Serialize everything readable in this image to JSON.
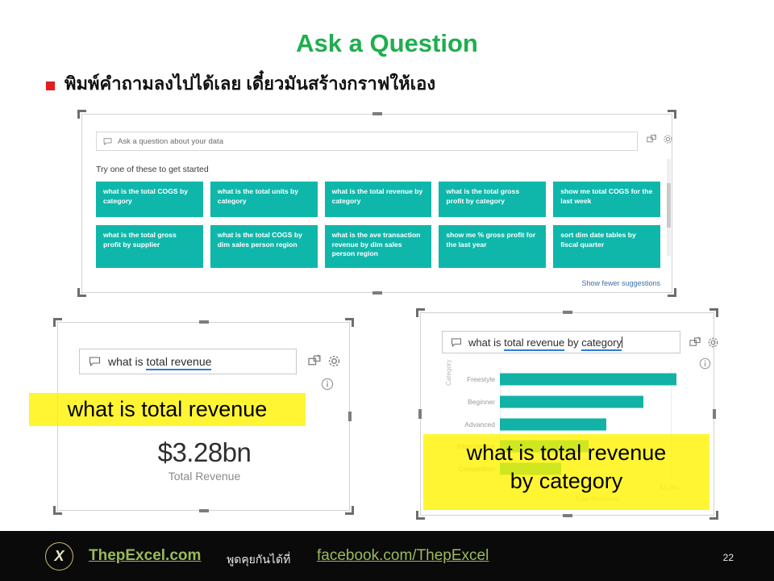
{
  "slide": {
    "title": "Ask a Question",
    "bullet": "พิมพ์คำถามลงไปได้เลย เดี๋ยวมันสร้างกราฟให้เอง",
    "page_number": "22",
    "accent_green": "#1FAE4E",
    "bullet_marker_color": "#E02020",
    "tile_teal": "#0FB7AB",
    "highlight_yellow": "#FFF200"
  },
  "qna_panel": {
    "search_placeholder": "Ask a question about your data",
    "suggestions_label": "Try one of these to get started",
    "show_fewer_label": "Show fewer suggestions",
    "pin_icon": "pin-visual-icon",
    "gear_icon": "gear-icon",
    "speech_icon": "speech-bubble-icon",
    "tiles_row1": [
      "what is the total COGS by category",
      "what is the total units by category",
      "what is the total revenue by category",
      "what is the total gross profit by category",
      "show me total COGS for the last week"
    ],
    "tiles_row2": [
      "what is the total gross profit by supplier",
      "what is the total COGS by dim sales person region",
      "what is the ave transaction revenue by dim sales person region",
      "show me % gross profit for the last year",
      "sort dim date tables by fiscal quarter"
    ]
  },
  "card_left": {
    "query_prefix": "what is ",
    "query_underlined": "total revenue",
    "big_value": "$3.28bn",
    "caption": "Total Revenue",
    "pin_icon": "pin-visual-icon",
    "gear_icon": "gear-icon",
    "info_icon": "info-icon",
    "speech_icon": "speech-bubble-icon",
    "highlight": "what is total revenue"
  },
  "card_right": {
    "query_prefix": "what is ",
    "query_underlined_1": "total revenue",
    "query_middle": " by ",
    "query_underlined_2": "category",
    "pin_icon": "pin-visual-icon",
    "gear_icon": "gear-icon",
    "info_icon": "info-icon",
    "speech_icon": "speech-bubble-icon",
    "highlight": "what is total revenue\nby category"
  },
  "chart_data": {
    "type": "bar",
    "orientation": "horizontal",
    "title": "",
    "categories": [
      "Freestyle",
      "Beginner",
      "Advanced",
      "Intermediate",
      "Competition"
    ],
    "values": [
      1.03,
      0.84,
      0.62,
      0.52,
      0.36
    ],
    "series": [
      {
        "name": "Total Revenue",
        "values": [
          1.03,
          0.84,
          0.62,
          0.52,
          0.36
        ]
      }
    ],
    "xlabel": "Total Revenue",
    "ylabel": "Category",
    "xticks": [
      "",
      "$1.0bn"
    ],
    "xtick_values": [
      0,
      1.0
    ],
    "xlim": [
      0,
      1.15
    ],
    "grid": true,
    "legend": "none",
    "bar_color": "#12B2A6"
  },
  "footer": {
    "logo_text": "X",
    "site": "ThepExcel.com",
    "thai_text": "พูดคุยกันได้ที่",
    "facebook": "facebook.com/ThepExcel"
  }
}
